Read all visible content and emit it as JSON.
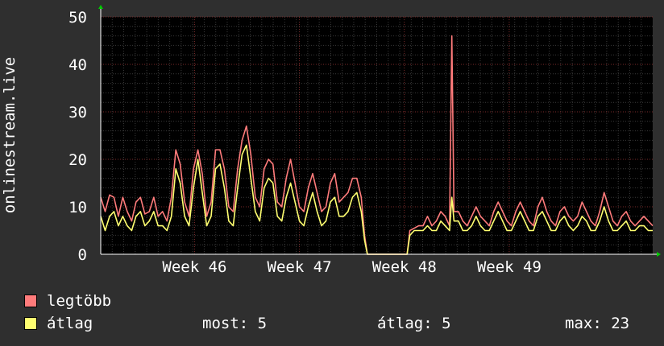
{
  "chart_data": {
    "type": "line",
    "ylabel": "onlinestream.live",
    "ylim": [
      0,
      50
    ],
    "yticks": [
      0,
      10,
      20,
      30,
      40,
      50
    ],
    "xlim": [
      0,
      100
    ],
    "xticks": [
      {
        "label": "Week 46",
        "x": 17
      },
      {
        "label": "Week 47",
        "x": 36
      },
      {
        "label": "Week 48",
        "x": 55
      },
      {
        "label": "Week 49",
        "x": 74
      }
    ],
    "grid": true,
    "series": [
      {
        "name": "legtöbb",
        "color": "#ff7b7b",
        "points": [
          [
            0,
            12
          ],
          [
            0.8,
            9
          ],
          [
            1.6,
            12.5
          ],
          [
            2.4,
            12
          ],
          [
            3.2,
            8
          ],
          [
            4,
            12
          ],
          [
            4.8,
            9
          ],
          [
            5.6,
            7
          ],
          [
            6.4,
            11
          ],
          [
            7.2,
            12
          ],
          [
            8,
            8.5
          ],
          [
            8.8,
            9
          ],
          [
            9.6,
            12
          ],
          [
            10.4,
            8
          ],
          [
            11.2,
            9
          ],
          [
            12,
            7
          ],
          [
            12.8,
            12
          ],
          [
            13.6,
            22
          ],
          [
            14.4,
            19
          ],
          [
            15.2,
            11
          ],
          [
            16,
            8
          ],
          [
            16.8,
            18
          ],
          [
            17.6,
            22
          ],
          [
            18.4,
            17
          ],
          [
            19.2,
            8
          ],
          [
            20,
            11
          ],
          [
            20.8,
            22
          ],
          [
            21.6,
            22
          ],
          [
            22.4,
            18
          ],
          [
            23.2,
            10
          ],
          [
            24,
            9
          ],
          [
            24.8,
            18
          ],
          [
            25.6,
            24
          ],
          [
            26.4,
            27
          ],
          [
            27.2,
            21
          ],
          [
            28,
            12
          ],
          [
            28.8,
            10
          ],
          [
            29.6,
            18
          ],
          [
            30.4,
            20
          ],
          [
            31.2,
            19
          ],
          [
            32,
            11
          ],
          [
            32.8,
            10
          ],
          [
            33.6,
            16
          ],
          [
            34.4,
            20
          ],
          [
            35.2,
            15
          ],
          [
            36,
            10
          ],
          [
            36.8,
            9
          ],
          [
            37.6,
            14
          ],
          [
            38.4,
            17
          ],
          [
            39.2,
            13
          ],
          [
            40,
            9
          ],
          [
            40.8,
            10
          ],
          [
            41.6,
            15
          ],
          [
            42.4,
            17
          ],
          [
            43.2,
            11
          ],
          [
            44,
            12
          ],
          [
            44.8,
            13
          ],
          [
            45.6,
            16
          ],
          [
            46.4,
            16
          ],
          [
            47.2,
            12
          ],
          [
            47.8,
            4
          ],
          [
            48.3,
            0
          ],
          [
            55,
            0
          ],
          [
            55.5,
            0
          ],
          [
            56,
            5
          ],
          [
            56.8,
            5.5
          ],
          [
            57.6,
            6
          ],
          [
            58.4,
            6
          ],
          [
            59.2,
            8
          ],
          [
            60,
            6
          ],
          [
            60.8,
            7
          ],
          [
            61.6,
            9
          ],
          [
            62.4,
            8
          ],
          [
            63.2,
            6
          ],
          [
            63.6,
            46
          ],
          [
            64,
            9
          ],
          [
            64.8,
            9
          ],
          [
            65.6,
            7
          ],
          [
            66.4,
            6
          ],
          [
            67.2,
            8
          ],
          [
            68,
            10
          ],
          [
            68.8,
            8
          ],
          [
            69.6,
            7
          ],
          [
            70.4,
            6
          ],
          [
            71.2,
            9
          ],
          [
            72,
            11
          ],
          [
            72.8,
            9
          ],
          [
            73.6,
            7
          ],
          [
            74.4,
            6
          ],
          [
            75.2,
            9
          ],
          [
            76,
            11
          ],
          [
            76.8,
            9
          ],
          [
            77.6,
            7
          ],
          [
            78.4,
            6
          ],
          [
            79.2,
            10
          ],
          [
            80,
            12
          ],
          [
            80.8,
            9
          ],
          [
            81.6,
            7
          ],
          [
            82.4,
            6
          ],
          [
            83.2,
            9
          ],
          [
            84,
            10
          ],
          [
            84.8,
            8
          ],
          [
            85.6,
            7
          ],
          [
            86.4,
            8
          ],
          [
            87.2,
            11
          ],
          [
            88,
            9
          ],
          [
            88.8,
            7
          ],
          [
            89.6,
            6
          ],
          [
            90.4,
            9
          ],
          [
            91.2,
            13
          ],
          [
            92,
            10
          ],
          [
            92.8,
            7
          ],
          [
            93.6,
            6
          ],
          [
            94.4,
            8
          ],
          [
            95.2,
            9
          ],
          [
            96,
            7
          ],
          [
            96.8,
            6
          ],
          [
            97.6,
            7
          ],
          [
            98.4,
            8
          ],
          [
            99.2,
            7
          ],
          [
            100,
            6
          ]
        ]
      },
      {
        "name": "átlag",
        "color": "#ffff70",
        "points": [
          [
            0,
            8
          ],
          [
            0.8,
            5
          ],
          [
            1.6,
            8
          ],
          [
            2.4,
            9
          ],
          [
            3.2,
            6
          ],
          [
            4,
            8
          ],
          [
            4.8,
            6
          ],
          [
            5.6,
            5
          ],
          [
            6.4,
            8
          ],
          [
            7.2,
            9
          ],
          [
            8,
            6
          ],
          [
            8.8,
            7
          ],
          [
            9.6,
            9
          ],
          [
            10.4,
            6
          ],
          [
            11.2,
            6
          ],
          [
            12,
            5
          ],
          [
            12.8,
            8
          ],
          [
            13.6,
            18
          ],
          [
            14.4,
            15
          ],
          [
            15.2,
            8
          ],
          [
            16,
            6
          ],
          [
            16.8,
            14
          ],
          [
            17.6,
            20
          ],
          [
            18.4,
            13
          ],
          [
            19.2,
            6
          ],
          [
            20,
            8
          ],
          [
            20.8,
            18
          ],
          [
            21.6,
            19
          ],
          [
            22.4,
            14
          ],
          [
            23.2,
            7
          ],
          [
            24,
            6
          ],
          [
            24.8,
            14
          ],
          [
            25.6,
            21
          ],
          [
            26.4,
            23
          ],
          [
            27.2,
            16
          ],
          [
            28,
            9
          ],
          [
            28.8,
            7
          ],
          [
            29.6,
            14
          ],
          [
            30.4,
            16
          ],
          [
            31.2,
            15
          ],
          [
            32,
            8
          ],
          [
            32.8,
            7
          ],
          [
            33.6,
            12
          ],
          [
            34.4,
            15
          ],
          [
            35.2,
            11
          ],
          [
            36,
            7
          ],
          [
            36.8,
            6
          ],
          [
            37.6,
            10
          ],
          [
            38.4,
            13
          ],
          [
            39.2,
            9
          ],
          [
            40,
            6
          ],
          [
            40.8,
            7
          ],
          [
            41.6,
            11
          ],
          [
            42.4,
            12
          ],
          [
            43.2,
            8
          ],
          [
            44,
            8
          ],
          [
            44.8,
            9
          ],
          [
            45.6,
            12
          ],
          [
            46.4,
            13
          ],
          [
            47.2,
            9
          ],
          [
            47.8,
            3
          ],
          [
            48.3,
            0
          ],
          [
            55,
            0
          ],
          [
            55.5,
            0
          ],
          [
            56,
            4
          ],
          [
            56.8,
            5
          ],
          [
            57.6,
            5
          ],
          [
            58.4,
            5
          ],
          [
            59.2,
            6
          ],
          [
            60,
            5
          ],
          [
            60.8,
            5
          ],
          [
            61.6,
            7
          ],
          [
            62.4,
            6
          ],
          [
            63.2,
            5
          ],
          [
            63.6,
            12
          ],
          [
            64,
            7
          ],
          [
            64.8,
            7
          ],
          [
            65.6,
            5
          ],
          [
            66.4,
            5
          ],
          [
            67.2,
            6
          ],
          [
            68,
            8
          ],
          [
            68.8,
            6
          ],
          [
            69.6,
            5
          ],
          [
            70.4,
            5
          ],
          [
            71.2,
            7
          ],
          [
            72,
            9
          ],
          [
            72.8,
            7
          ],
          [
            73.6,
            5
          ],
          [
            74.4,
            5
          ],
          [
            75.2,
            7
          ],
          [
            76,
            9
          ],
          [
            76.8,
            7
          ],
          [
            77.6,
            5
          ],
          [
            78.4,
            5
          ],
          [
            79.2,
            8
          ],
          [
            80,
            9
          ],
          [
            80.8,
            7
          ],
          [
            81.6,
            5
          ],
          [
            82.4,
            5
          ],
          [
            83.2,
            7
          ],
          [
            84,
            8
          ],
          [
            84.8,
            6
          ],
          [
            85.6,
            5
          ],
          [
            86.4,
            6
          ],
          [
            87.2,
            8
          ],
          [
            88,
            7
          ],
          [
            88.8,
            5
          ],
          [
            89.6,
            5
          ],
          [
            90.4,
            7
          ],
          [
            91.2,
            10
          ],
          [
            92,
            7
          ],
          [
            92.8,
            5
          ],
          [
            93.6,
            5
          ],
          [
            94.4,
            6
          ],
          [
            95.2,
            7
          ],
          [
            96,
            5
          ],
          [
            96.8,
            5
          ],
          [
            97.6,
            6
          ],
          [
            98.4,
            6
          ],
          [
            99.2,
            5
          ],
          [
            100,
            5
          ]
        ]
      }
    ]
  },
  "legend": {
    "max_label": "legtöbb",
    "avg_label": "átlag",
    "max_color": "#ff7b7b",
    "avg_color": "#ffff70"
  },
  "stats": {
    "now": "most: 5",
    "avg": "átlag: 5",
    "max": "max: 23"
  }
}
